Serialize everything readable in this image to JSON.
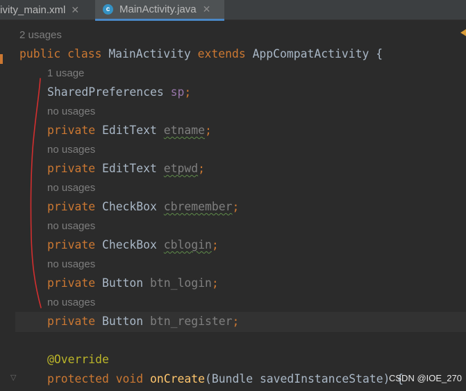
{
  "tabs": [
    {
      "label": "tivity_main.xml",
      "close": "✕"
    },
    {
      "label": "MainActivity.java",
      "icon": "c-class-icon",
      "icon_letter": "c",
      "close": "✕"
    }
  ],
  "hints": {
    "class_usages": "2 usages",
    "sp_usages": "1 usage",
    "no_usages": "no usages"
  },
  "code": {
    "class_line": {
      "public": "public",
      "class": "class",
      "name": "MainActivity",
      "extends": "extends",
      "super": "AppCompatActivity",
      "brace": "{"
    },
    "fields": [
      {
        "modifier": "",
        "type": "SharedPreferences",
        "name": "sp",
        "semi": ";"
      },
      {
        "modifier": "private",
        "type": "EditText",
        "name": "etname",
        "semi": ";"
      },
      {
        "modifier": "private",
        "type": "EditText",
        "name": "etpwd",
        "semi": ";"
      },
      {
        "modifier": "private",
        "type": "CheckBox",
        "name": "cbremember",
        "semi": ";"
      },
      {
        "modifier": "private",
        "type": "CheckBox",
        "name": "cblogin",
        "semi": ";"
      },
      {
        "modifier": "private",
        "type": "Button",
        "name": "btn_login",
        "semi": ";"
      },
      {
        "modifier": "private",
        "type": "Button",
        "name": "btn_register",
        "semi": ";"
      }
    ],
    "annotation": "@Override",
    "method_line": {
      "protected": "protected",
      "void": "void",
      "name": "onCreate",
      "params": "(Bundle savedInstanceState) {"
    }
  },
  "watermark": "CSDN @IOE_270",
  "colors": {
    "keyword": "#cc7832",
    "field": "#9876aa",
    "text": "#a9b7c6",
    "annotation": "#bbb529",
    "method": "#ffc66d",
    "hint": "#7e7e7e",
    "background": "#2b2b2b",
    "annotation_mark": "#d32f2f"
  }
}
